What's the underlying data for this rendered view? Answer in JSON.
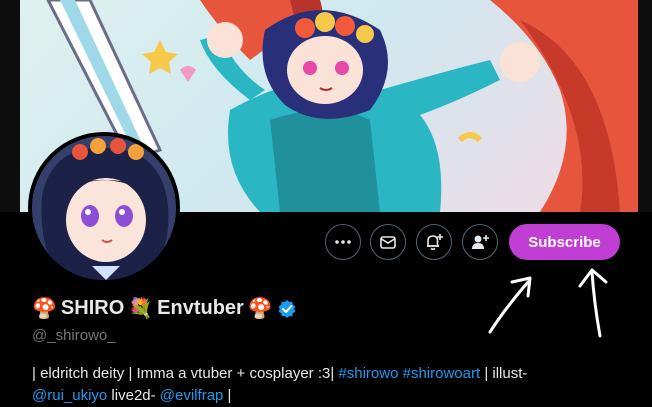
{
  "profile": {
    "display_name_prefix_emoji": "🍄",
    "display_name_main": "SHIRO",
    "display_name_flower_emoji": "💐",
    "display_name_suffix": "Envtuber",
    "display_name_suffix_emoji": "🍄",
    "verified": true,
    "handle": "@_shirowo_"
  },
  "actions": {
    "more_icon": "ellipsis-icon",
    "message_icon": "envelope-icon",
    "notify_icon": "bell-plus-icon",
    "follow_icon": "person-plus-icon",
    "subscribe_label": "Subscribe"
  },
  "bio": {
    "part1": "| eldritch deity | Imma a vtuber + cosplayer :3| ",
    "hashtag1": "#shirowo",
    "space": " ",
    "hashtag2": "#shirowoart",
    "part2": " | illust-",
    "mention1": "@rui_ukiyo",
    "part3": " live2d- ",
    "mention2": "@evilfrap",
    "part4": " |"
  },
  "colors": {
    "subscribe_bg": "#c13ed4",
    "link": "#1d9bf0",
    "verified": "#1d9bf0"
  }
}
